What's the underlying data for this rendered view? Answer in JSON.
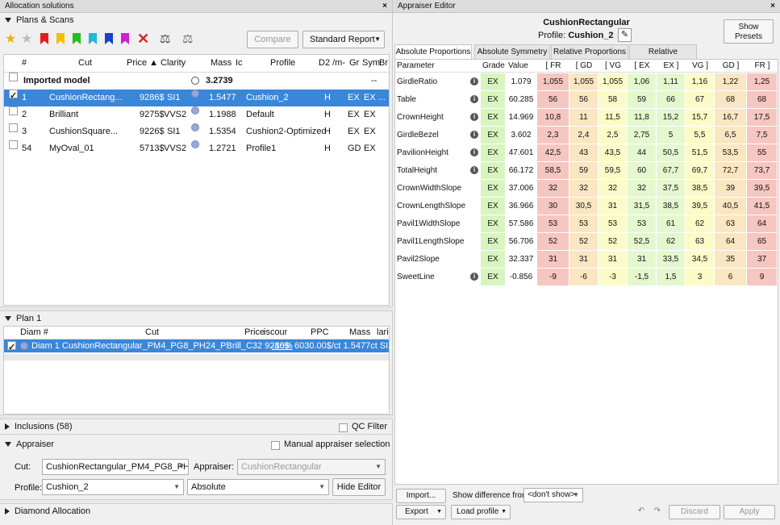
{
  "left": {
    "title": "Allocation solutions",
    "close": "×",
    "plans_scans": "Plans & Scans",
    "compare": "Compare",
    "standard_report": "Standard Report",
    "columns": [
      "#",
      "Cut",
      "Price ▲",
      "Clarity",
      "Mass",
      "Ic",
      "Profile",
      "D2 /m-",
      "Gr",
      "Sym",
      "Br"
    ],
    "rows": [
      {
        "num": "",
        "cut": "Imported model",
        "price": "",
        "clarity": "",
        "mass": "3.2739",
        "profile": "",
        "d": "",
        "gr": "",
        "sym": "--",
        "group": true
      },
      {
        "num": "1",
        "cut": "CushionRectang...",
        "price": "9286$",
        "clarity": "SI1",
        "mass": "1.5477",
        "profile": "Cushion_2",
        "d": "H",
        "gr": "EX",
        "sym": "EX ...",
        "sel": true,
        "checked": true
      },
      {
        "num": "2",
        "cut": "Brilliant",
        "price": "9275$",
        "clarity": "VVS2",
        "mass": "1.1988",
        "profile": "Default",
        "d": "H",
        "gr": "EX",
        "sym": "EX"
      },
      {
        "num": "3",
        "cut": "CushionSquare...",
        "price": "9226$",
        "clarity": "SI1",
        "mass": "1.5354",
        "profile": "Cushion2-Optimized",
        "d": "H",
        "gr": "EX",
        "sym": "EX"
      },
      {
        "num": "54",
        "cut": "MyOval_01",
        "price": "5713$",
        "clarity": "VVS2",
        "mass": "1.2721",
        "profile": "Profile1",
        "d": "H",
        "gr": "GD",
        "sym": "EX"
      }
    ],
    "plan1": "Plan 1",
    "plan_cols": [
      "Diam #",
      "Cut",
      "Price",
      "iscour",
      "PPC",
      "Mass",
      "lari"
    ],
    "plan_row": "Diam 1  CushionRectangular_PM4_PG8_PH24_PBrill_C32  9286$",
    "plan_disc": "-10%",
    "plan_rest": "6030.00$/ct  1.5477ct  SI1",
    "inclusions": "Inclusions (58)",
    "qc_filter": "QC Filter",
    "appraiser": "Appraiser",
    "manual_sel": "Manual appraiser selection",
    "cut_label": "Cut:",
    "cut_value": "CushionRectangular_PM4_PG8_PH2",
    "appraiser_label": "Appraiser:",
    "appraiser_value": "CushionRectangular",
    "profile_label": "Profile:",
    "profile_value": "Cushion_2",
    "absolute_value": "Absolute",
    "hide_editor": "Hide Editor",
    "diamond_alloc": "Diamond Allocation"
  },
  "right": {
    "title": "Appraiser Editor",
    "close": "×",
    "name": "CushionRectangular",
    "profile_label": "Profile:",
    "profile_value": "Cushion_2",
    "show_presets": "Show Presets",
    "tabs": [
      "Absolute Proportions",
      "Absolute Symmetry",
      "Relative Proportions",
      "Relative Symmetry"
    ],
    "headers": [
      "Parameter",
      "Grade",
      "Value",
      "[ FR",
      "[ GD",
      "[ VG",
      "[ EX",
      "EX ]",
      "VG ]",
      "GD ]",
      "FR ]"
    ],
    "rows": [
      {
        "p": "GirdleRatio",
        "i": true,
        "g": "EX",
        "v": "1.079",
        "c": [
          "1,055",
          "1,055",
          "1,055",
          "1,06",
          "1,11",
          "1,16",
          "1,22",
          "1,25"
        ]
      },
      {
        "p": "Table",
        "i": true,
        "g": "EX",
        "v": "60.285",
        "c": [
          "56",
          "56",
          "58",
          "59",
          "66",
          "67",
          "68",
          "68"
        ]
      },
      {
        "p": "CrownHeight",
        "i": true,
        "g": "EX",
        "v": "14.969",
        "c": [
          "10,8",
          "11",
          "11,5",
          "11,8",
          "15,2",
          "15,7",
          "16,7",
          "17,5"
        ]
      },
      {
        "p": "GirdleBezel",
        "i": true,
        "g": "EX",
        "v": "3.602",
        "c": [
          "2,3",
          "2,4",
          "2,5",
          "2,75",
          "5",
          "5,5",
          "6,5",
          "7,5"
        ]
      },
      {
        "p": "PavilionHeight",
        "i": true,
        "g": "EX",
        "v": "47.601",
        "c": [
          "42,5",
          "43",
          "43,5",
          "44",
          "50,5",
          "51,5",
          "53,5",
          "55"
        ]
      },
      {
        "p": "TotalHeight",
        "i": true,
        "g": "EX",
        "v": "66.172",
        "c": [
          "58,5",
          "59",
          "59,5",
          "60",
          "67,7",
          "69,7",
          "72,7",
          "73,7"
        ]
      },
      {
        "p": "CrownWidthSlope",
        "i": false,
        "g": "EX",
        "v": "37.006",
        "c": [
          "32",
          "32",
          "32",
          "32",
          "37,5",
          "38,5",
          "39",
          "39,5"
        ]
      },
      {
        "p": "CrownLengthSlope",
        "i": false,
        "g": "EX",
        "v": "36.966",
        "c": [
          "30",
          "30,5",
          "31",
          "31,5",
          "38,5",
          "39,5",
          "40,5",
          "41,5"
        ]
      },
      {
        "p": "Pavil1WidthSlope",
        "i": false,
        "g": "EX",
        "v": "57.586",
        "c": [
          "53",
          "53",
          "53",
          "53",
          "61",
          "62",
          "63",
          "64"
        ]
      },
      {
        "p": "Pavil1LengthSlope",
        "i": false,
        "g": "EX",
        "v": "56.706",
        "c": [
          "52",
          "52",
          "52",
          "52,5",
          "62",
          "63",
          "64",
          "65"
        ]
      },
      {
        "p": "Pavil2Slope",
        "i": false,
        "g": "EX",
        "v": "32.337",
        "c": [
          "31",
          "31",
          "31",
          "31",
          "33,5",
          "34,5",
          "35",
          "37"
        ]
      },
      {
        "p": "SweetLine",
        "i": true,
        "g": "EX",
        "v": "-0.856",
        "c": [
          "-9",
          "-6",
          "-3",
          "-1,5",
          "1,5",
          "3",
          "6",
          "9"
        ]
      }
    ],
    "import": "Import...",
    "show_diff": "Show difference from:",
    "dont_show": "<don't show>",
    "export": "Export",
    "load_profile": "Load profile",
    "discard": "Discard",
    "apply": "Apply",
    "colors": {
      "fr": "#f6c6c0",
      "gd": "#fbe6c2",
      "vg": "#fbfbc8",
      "ex": "#e5f7cf",
      "grade": "#d8f5c0"
    }
  }
}
